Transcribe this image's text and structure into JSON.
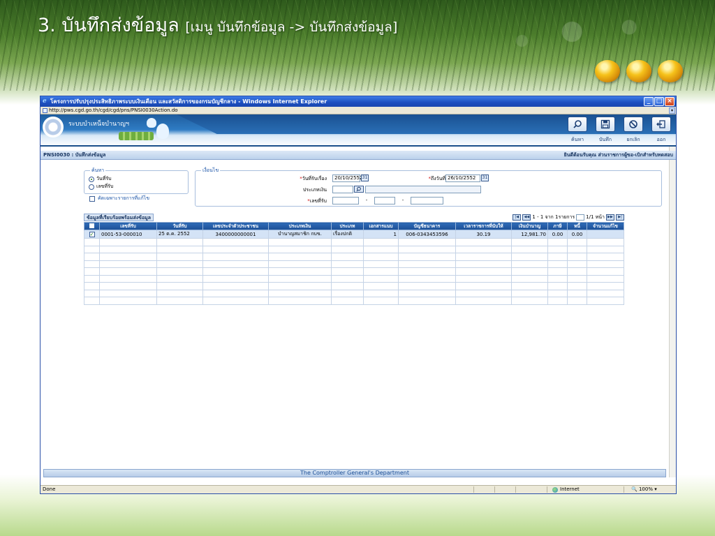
{
  "slide": {
    "title": "3. บันทึกส่งข้อมูล",
    "subtitle": "[เมนู บันทึกข้อมูล -> บันทึกส่งข้อมูล]"
  },
  "window": {
    "title": "โครงการปรับปรุงประสิทธิภาพระบบเงินเดือน และสวัสดิการของกรมบัญชีกลาง - Windows Internet Explorer",
    "url": "http://pws.cgd.go.th/cgd/cgd/pns/PNSI0030Action.do"
  },
  "banner": {
    "app_name": "ระบบบำเหน็จบำนาญฯ"
  },
  "toolbar": {
    "search_label": "ค้นหา",
    "save_label": "บันทึก",
    "cancel_label": "ยกเลิก",
    "exit_label": "ออก"
  },
  "page": {
    "code_title": "PNSI0030 : บันทึกส่งข้อมูล",
    "welcome": "ยินดีต้อนรับคุณ ส่วนราชการผู้ขอ-เบิกสำหรับทดสอบ"
  },
  "search_by": {
    "legend": "ค้นหา",
    "option_date": "วันที่รับ",
    "option_number": "เลขที่รับ",
    "filter_label": "คัดเฉพาะรายการที่แก้ไข"
  },
  "conditions": {
    "legend": "เงื่อนไข",
    "date_from_label": "วันที่รับเรื่อง",
    "date_from_value": "20/10/2552",
    "date_to_label": "ถึงวันที่",
    "date_to_value": "26/10/2552",
    "money_type_label": "ประเภทเงิน",
    "receipt_no_label": "เลขที่รับ",
    "calendar_glyph": "31",
    "dash": "-"
  },
  "grid": {
    "title": "ข้อมูลที่เรียบร้อยพร้อมส่งข้อมูล",
    "pager": {
      "text_range": "1 - 1 จาก 1รายการ",
      "page_label": "1/1 หน้า"
    },
    "columns": [
      "เลขที่รับ",
      "วันที่รับ",
      "เลขประจำตัวประชาชน",
      "ประเภทเงิน",
      "ประเภท",
      "เอกสารแนบ",
      "บัญชีธนาคาร",
      "เวลาราชการที่นับให้",
      "เงินบำนาญ",
      "ภาษี",
      "หนี้",
      "จำนวนแก้ไข"
    ],
    "rows": [
      {
        "checked": "✓",
        "receipt_no": "0001-53-000010",
        "receipt_date": "25 ต.ค. 2552",
        "citizen_id": "3400000000001",
        "money_type": "บำนาญสมาชิก กบข.",
        "type": "เรื่องปกติ",
        "attachments": "1",
        "bank_account": "006-0343453596",
        "service_time": "30.19",
        "pension": "12,981.70",
        "tax": "0.00",
        "debt": "0.00",
        "edits": ""
      }
    ]
  },
  "footer": {
    "department": "The Comptroller General's Department"
  },
  "status": {
    "done": "Done",
    "zone": "Internet",
    "zoom": "100%"
  }
}
